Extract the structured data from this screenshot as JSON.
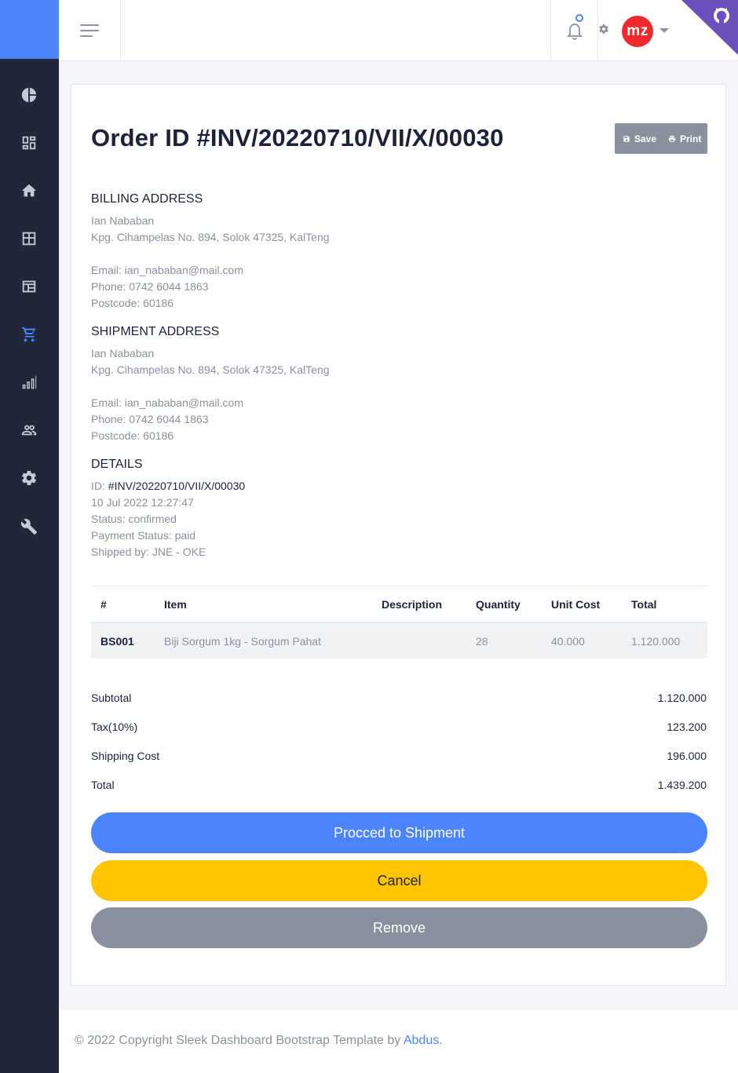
{
  "header": {
    "avatar_initials": "mz",
    "accent_color": "#4c84ff"
  },
  "sidebar": {
    "items": [
      {
        "icon": "pie-chart-icon"
      },
      {
        "icon": "dashboard-icon"
      },
      {
        "icon": "home-icon"
      },
      {
        "icon": "table-icon"
      },
      {
        "icon": "layout-icon"
      },
      {
        "icon": "cart-icon",
        "active": true
      },
      {
        "icon": "bar-chart-icon"
      },
      {
        "icon": "users-icon"
      },
      {
        "icon": "settings-icon"
      },
      {
        "icon": "wrench-icon"
      }
    ]
  },
  "order": {
    "title": "Order ID #INV/20220710/VII/X/00030",
    "save_label": "Save",
    "print_label": "Print"
  },
  "billing": {
    "title": "BILLING ADDRESS",
    "name": "Ian Nababan",
    "address": "Kpg. Cihampelas No. 894, Solok 47325, KalTeng",
    "email": "Email: ian_nababan@mail.com",
    "phone": "Phone: 0742 6044 1863",
    "postcode": "Postcode: 60186"
  },
  "shipment": {
    "title": "SHIPMENT ADDRESS",
    "name": "Ian Nababan",
    "address": "Kpg. Cihampelas No. 894, Solok 47325, KalTeng",
    "email": "Email: ian_nababan@mail.com",
    "phone": "Phone: 0742 6044 1863",
    "postcode": "Postcode: 60186"
  },
  "details": {
    "title": "DETAILS",
    "id_label": "ID: ",
    "id_value": "#INV/20220710/VII/X/00030",
    "date": "10 Jul 2022 12:27:47",
    "status": "Status: confirmed",
    "payment_status": "Payment Status: paid",
    "shipped_by": "Shipped by: JNE - OKE"
  },
  "table": {
    "headers": [
      "#",
      "Item",
      "Description",
      "Quantity",
      "Unit Cost",
      "Total"
    ],
    "rows": [
      {
        "code": "BS001",
        "item": "Biji Sorgum 1kg - Sorgum Pahat",
        "description": "",
        "quantity": "28",
        "unit_cost": "40.000",
        "total": "1.120.000"
      }
    ]
  },
  "summary": {
    "subtotal_label": "Subtotal",
    "subtotal": "1.120.000",
    "tax_label": "Tax(10%)",
    "tax": "123.200",
    "shipping_label": "Shipping Cost",
    "shipping": "196.000",
    "total_label": "Total",
    "total": "1.439.200"
  },
  "actions": {
    "proceed": "Procced to Shipment",
    "cancel": "Cancel",
    "remove": "Remove"
  },
  "footer": {
    "text": "© 2022 Copyright Sleek Dashboard Bootstrap Template by ",
    "link": "Abdus",
    "suffix": "."
  }
}
